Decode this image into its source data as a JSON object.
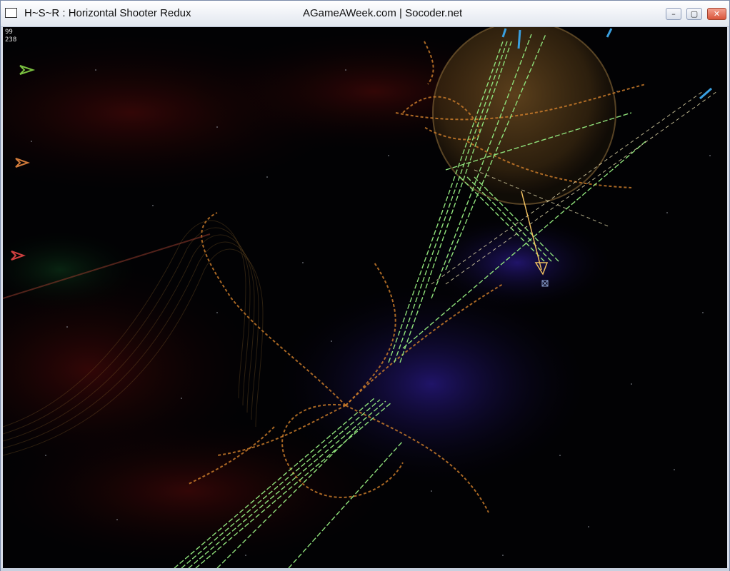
{
  "window": {
    "title": "H~S~R : Horizontal Shooter Redux",
    "title_right": "AGameAWeek.com | Socoder.net",
    "buttons": {
      "minimize": "–",
      "maximize": "▢",
      "close": "✕"
    }
  },
  "hud": {
    "counter_top": "99",
    "counter_bottom": "238"
  },
  "lives_icons": [
    "ship-icon-green",
    "ship-icon-orange",
    "ship-icon-red"
  ],
  "colors": {
    "background": "#020204",
    "planet": "#c89a4a",
    "laser_green": "#8ee07a",
    "laser_blue": "#3aa0e0",
    "trail_orange": "#c87a2a",
    "player": "#f0c060"
  }
}
